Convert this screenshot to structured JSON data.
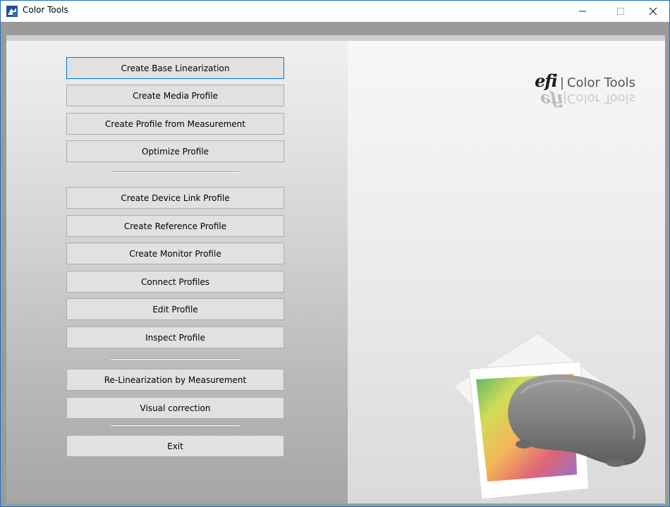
{
  "window": {
    "title": "Color Tools",
    "icons": {
      "app": "color-tools-app-icon",
      "minimize": "minimize-icon",
      "maximize": "maximize-icon",
      "close": "close-icon"
    }
  },
  "menu": {
    "create_base_linearization": "Create Base Linearization",
    "create_media_profile": "Create Media Profile",
    "create_profile_from_measurement": "Create Profile from Measurement",
    "optimize_profile": "Optimize Profile",
    "create_device_link_profile": "Create Device Link Profile",
    "create_reference_profile": "Create Reference Profile",
    "create_monitor_profile": "Create Monitor Profile",
    "connect_profiles": "Connect Profiles",
    "edit_profile": "Edit Profile",
    "inspect_profile": "Inspect Profile",
    "re_linearization_by_measurement": "Re-Linearization by Measurement",
    "visual_correction": "Visual correction",
    "exit": "Exit"
  },
  "branding": {
    "logo_mark": "efi",
    "divider": "|",
    "product_name": "Color Tools"
  },
  "colors": {
    "focus_border": "#0078d7",
    "button_face": "#e1e1e1"
  }
}
